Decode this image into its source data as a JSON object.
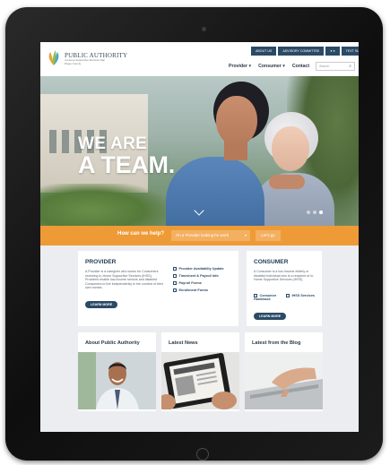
{
  "site": {
    "brand": "PUBLIC AUTHORITY",
    "brand_sub": "In-Home Supportive Services San Diego County"
  },
  "topbar": [
    "ABOUT US",
    "ADVISORY COMMITTEE",
    "TEXT SIZE"
  ],
  "topbar_icons": [
    "facebook-icon",
    "twitter-icon"
  ],
  "nav": {
    "items": [
      "Provider",
      "Consumer",
      "Contact"
    ],
    "search_placeholder": "Search"
  },
  "hero": {
    "line1": "WE ARE",
    "line2": "A TEAM."
  },
  "help_band": {
    "question": "How can we help?",
    "select_value": "I'm a Provider looking for work",
    "go_label": "Let's go"
  },
  "provider": {
    "title": "PROVIDER",
    "text": "A Provider is a caregiver who works for Consumers receiving In-Home Supportive Services (IHSS). Providers enable low-income seniors and disabled Consumers to live independently in the comfort of their own homes.",
    "button": "LEARN MORE",
    "links": [
      "Provider Availability Update",
      "Timesheet & Payroll Info",
      "Payroll Forms",
      "Enrollment Forms"
    ]
  },
  "consumer": {
    "title": "CONSUMER",
    "text": "A Consumer is a low-income elderly or disabled individual who is a recipient of In-Home Supportive Services (IHSS).",
    "button": "LEARN MORE",
    "links": [
      "Consumer Handbook",
      "IHSS Services"
    ]
  },
  "tiles": [
    "About Public Authority",
    "Latest News",
    "Latest from the Blog"
  ],
  "colors": {
    "navy": "#2b4a66",
    "orange": "#ee9a36",
    "page_bg": "#ecedf1"
  }
}
